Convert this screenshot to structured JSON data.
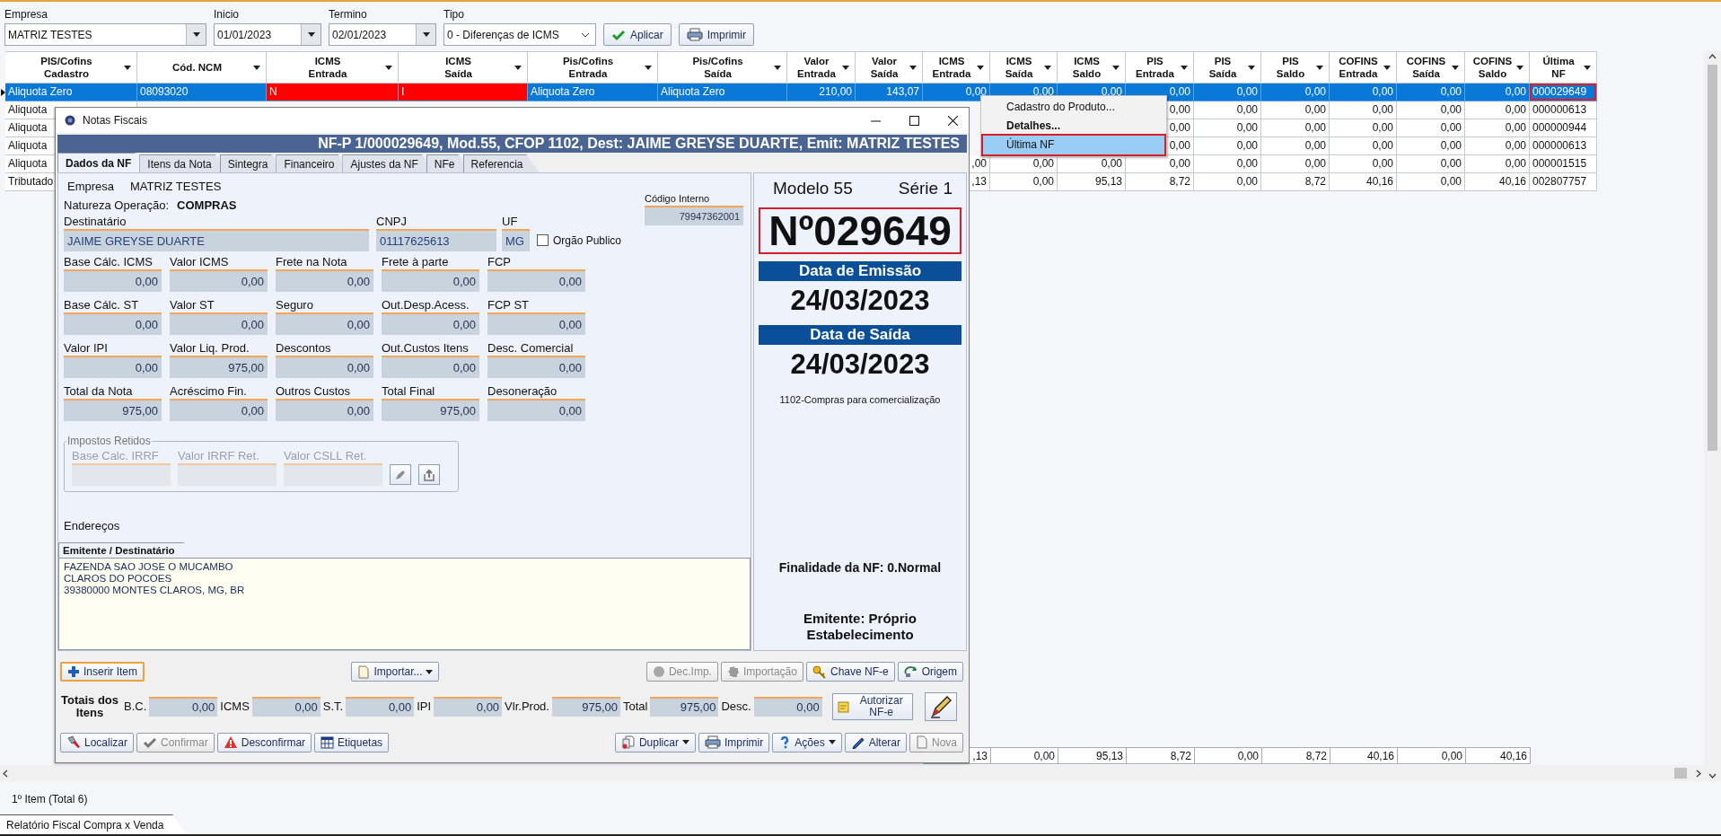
{
  "filters": {
    "fields": [
      {
        "label": "Empresa",
        "value": "MATRIZ TESTES",
        "kind": "combo"
      },
      {
        "label": "Inicio",
        "value": "01/01/2023",
        "kind": "combo"
      },
      {
        "label": "Termino",
        "value": "02/01/2023",
        "kind": "combo"
      },
      {
        "label": "Tipo",
        "value": "0 - Diferenças de ICMS",
        "kind": "select"
      }
    ],
    "buttons": [
      {
        "label": "Aplicar",
        "kind": "check"
      },
      {
        "label": "Imprimir",
        "kind": "printer"
      }
    ]
  },
  "grid": {
    "columns": [
      {
        "lines": [
          "PIS/Cofins",
          "Cadastro"
        ]
      },
      {
        "lines": [
          "Cód. NCM"
        ]
      },
      {
        "lines": [
          "ICMS",
          "Entrada"
        ]
      },
      {
        "lines": [
          "ICMS",
          "Saída"
        ]
      },
      {
        "lines": [
          "Pis/Cofins",
          "Entrada"
        ]
      },
      {
        "lines": [
          "Pis/Cofins",
          "Saída"
        ]
      },
      {
        "lines": [
          "Valor",
          "Entrada"
        ]
      },
      {
        "lines": [
          "Valor",
          "Saída"
        ]
      },
      {
        "lines": [
          "ICMS",
          "Entrada"
        ]
      },
      {
        "lines": [
          "ICMS",
          "Saída"
        ]
      },
      {
        "lines": [
          "ICMS",
          "Saldo"
        ]
      },
      {
        "lines": [
          "PIS",
          "Entrada"
        ]
      },
      {
        "lines": [
          "PIS",
          "Saída"
        ]
      },
      {
        "lines": [
          "PIS",
          "Saldo"
        ]
      },
      {
        "lines": [
          "COFINS",
          "Entrada"
        ]
      },
      {
        "lines": [
          "COFINS",
          "Saída"
        ]
      },
      {
        "lines": [
          "COFINS",
          "Saldo"
        ]
      },
      {
        "lines": [
          "Última",
          "NF"
        ]
      }
    ],
    "rows": [
      {
        "selected": true,
        "cells": [
          "Aliquota Zero",
          "08093020",
          {
            "text": "N",
            "alert": true
          },
          {
            "text": "I",
            "alert": true
          },
          "Aliquota Zero",
          "Aliquota Zero",
          "210,00",
          "143,07",
          "0,00",
          "0,00",
          "0,00",
          "0,00",
          "0,00",
          "0,00",
          "0,00",
          "0,00",
          "0,00",
          {
            "text": "000029649",
            "highlighted": true
          }
        ]
      },
      {
        "selected": false,
        "cells": [
          "Aliquota",
          null,
          null,
          null,
          null,
          null,
          null,
          null,
          null,
          null,
          null,
          "0,00",
          "0,00",
          "0,00",
          "0,00",
          "0,00",
          "0,00",
          "000000613"
        ]
      },
      {
        "selected": false,
        "cells": [
          "Aliquota",
          null,
          null,
          null,
          null,
          null,
          null,
          null,
          null,
          null,
          null,
          "0,00",
          "0,00",
          "0,00",
          "0,00",
          "0,00",
          "0,00",
          "000000944"
        ]
      },
      {
        "selected": false,
        "cells": [
          "Aliquota",
          null,
          null,
          null,
          null,
          null,
          null,
          null,
          null,
          null,
          null,
          "0,00",
          "0,00",
          "0,00",
          "0,00",
          "0,00",
          "0,00",
          "000000613"
        ]
      },
      {
        "selected": false,
        "cells": [
          "Aliquota",
          null,
          null,
          null,
          null,
          null,
          null,
          null,
          ",00",
          "0,00",
          "0,00",
          "0,00",
          "0,00",
          "0,00",
          "0,00",
          "0,00",
          "0,00",
          "000001515"
        ]
      },
      {
        "selected": false,
        "cells": [
          "Tributado",
          null,
          null,
          null,
          null,
          null,
          null,
          null,
          ",13",
          "0,00",
          "95,13",
          "8,72",
          "0,00",
          "8,72",
          "40,16",
          "0,00",
          "40,16",
          "002807757"
        ]
      }
    ],
    "footer": [
      ",13",
      "0,00",
      "95,13",
      "8,72",
      "0,00",
      "8,72",
      "40,16",
      "0,00",
      "40,16"
    ]
  },
  "context_menu": {
    "items": [
      {
        "label": "Cadastro do Produto...",
        "bold": false,
        "selected": false,
        "highlighted": false
      },
      {
        "label": "Detalhes...",
        "bold": true,
        "selected": false,
        "highlighted": false
      },
      {
        "label": "Última NF",
        "bold": false,
        "selected": true,
        "highlighted": true
      }
    ]
  },
  "dialog": {
    "title": "Notas Fiscais",
    "banner": "NF-P 1/000029649, Mod.55, CFOP 1102, Dest: JAIME GREYSE DUARTE, Emit: MATRIZ TESTES",
    "tabs": [
      {
        "label": "Dados da NF",
        "selected": true
      },
      {
        "label": "Itens da Nota",
        "selected": false
      },
      {
        "label": "Sintegra",
        "selected": false
      },
      {
        "label": "Financeiro",
        "selected": false
      },
      {
        "label": "Ajustes da NF",
        "selected": false
      },
      {
        "label": "NFe",
        "selected": false
      },
      {
        "label": "Referencia",
        "selected": false
      }
    ],
    "empresa": {
      "label": "Empresa",
      "value": "MATRIZ TESTES"
    },
    "natureza": {
      "label": "Natureza Operação:",
      "value": "COMPRAS"
    },
    "codigo_interno": {
      "label": "Código Interno",
      "value": "79947362001"
    },
    "destinatario": {
      "label": "Destinatário",
      "value": "JAIME GREYSE DUARTE"
    },
    "cnpj": {
      "label": "CNPJ",
      "value": "01117625613"
    },
    "uf": {
      "label": "UF",
      "value": "MG"
    },
    "orgao_publico": {
      "label": "Orgão Publico",
      "checked": false
    },
    "amounts": [
      {
        "caption": "Base Cálc. ICMS",
        "amount": "0,00"
      },
      {
        "caption": "Valor ICMS",
        "amount": "0,00"
      },
      {
        "caption": "Frete na Nota",
        "amount": "0,00"
      },
      {
        "caption": "Frete à parte",
        "amount": "0,00"
      },
      {
        "caption": "FCP",
        "amount": "0,00"
      },
      {
        "caption": "Base Cálc. ST",
        "amount": "0,00"
      },
      {
        "caption": "Valor ST",
        "amount": "0,00"
      },
      {
        "caption": "Seguro",
        "amount": "0,00"
      },
      {
        "caption": "Out.Desp.Acess.",
        "amount": "0,00"
      },
      {
        "caption": "FCP ST",
        "amount": "0,00"
      },
      {
        "caption": "Valor IPI",
        "amount": "0,00"
      },
      {
        "caption": "Valor Liq. Prod.",
        "amount": "975,00"
      },
      {
        "caption": "Descontos",
        "amount": "0,00"
      },
      {
        "caption": "Out.Custos Itens",
        "amount": "0,00"
      },
      {
        "caption": "Desc. Comercial",
        "amount": "0,00"
      },
      {
        "caption": "Total da Nota",
        "amount": "975,00"
      },
      {
        "caption": "Acréscimo Fin.",
        "amount": "0,00"
      },
      {
        "caption": "Outros Custos",
        "amount": "0,00"
      },
      {
        "caption": "Total Final",
        "amount": "975,00"
      },
      {
        "caption": "Desoneração",
        "amount": "0,00"
      }
    ],
    "impostos_retidos": {
      "title": "Impostos Retidos",
      "fields": [
        {
          "label": "Base Calc. IRRF"
        },
        {
          "label": "Valor IRRF Ret."
        },
        {
          "label": "Valor CSLL Ret."
        }
      ]
    },
    "enderecos": {
      "label": "Endereços",
      "tab": "Emitente / Destinatário",
      "lines": [
        "FAZENDA SAO JOSE O MUCAMBO",
        "CLAROS DO POCOES",
        "39380000 MONTES CLAROS, MG, BR"
      ]
    },
    "summary": {
      "modelo": "Modelo 55",
      "serie": "Série 1",
      "numero": "Nº029649",
      "highlighted": true,
      "emissao_label": "Data de Emissão",
      "emissao": "24/03/2023",
      "saida_label": "Data de Saída",
      "saida": "24/03/2023",
      "cfop": "1102-Compras para comercialização",
      "finalidade": "Finalidade da NF: 0.Normal",
      "emitente": "Emitente: Próprio Estabelecimento"
    },
    "item_buttons": [
      {
        "label": "Inserir Item",
        "kind": "plus",
        "focused": true,
        "disabled": false,
        "dropdown": false
      },
      {
        "label": "Importar...",
        "kind": "document",
        "focused": false,
        "disabled": false,
        "dropdown": true
      },
      {
        "label": "Dec.Imp.",
        "kind": "circle",
        "focused": false,
        "disabled": true,
        "dropdown": false
      },
      {
        "label": "Importação",
        "kind": "seal",
        "focused": false,
        "disabled": true,
        "dropdown": false
      },
      {
        "label": "Chave NF-e",
        "kind": "key",
        "focused": false,
        "disabled": false,
        "dropdown": false
      },
      {
        "label": "Origem",
        "kind": "arrows",
        "focused": false,
        "disabled": false,
        "dropdown": false
      }
    ],
    "totals": {
      "title": "Totais dos Itens",
      "fields": [
        {
          "label": "B.C.",
          "value": "0,00"
        },
        {
          "label": "ICMS",
          "value": "0,00"
        },
        {
          "label": "S.T.",
          "value": "0,00"
        },
        {
          "label": "IPI",
          "value": "0,00"
        },
        {
          "label": "Vlr.Prod.",
          "value": "975,00"
        },
        {
          "label": "Total",
          "value": "975,00"
        },
        {
          "label": "Desc.",
          "value": "0,00"
        }
      ],
      "authorize": "Autorizar NF-e"
    },
    "bottom_buttons": [
      {
        "label": "Localizar",
        "kind": "flashlight",
        "focused": false,
        "disabled": false,
        "dropdown": false
      },
      {
        "label": "Confirmar",
        "kind": "check",
        "focused": false,
        "disabled": true,
        "dropdown": false
      },
      {
        "label": "Desconfirmar",
        "kind": "warning",
        "focused": false,
        "disabled": false,
        "dropdown": false
      },
      {
        "label": "Etiquetas",
        "kind": "table",
        "focused": false,
        "disabled": false,
        "dropdown": false
      },
      {
        "label": "Duplicar",
        "kind": "documents",
        "focused": false,
        "disabled": false,
        "dropdown": true
      },
      {
        "label": "Imprimir",
        "kind": "printer",
        "focused": false,
        "disabled": false,
        "dropdown": false
      },
      {
        "label": "Ações",
        "kind": "help",
        "focused": false,
        "disabled": false,
        "dropdown": true
      },
      {
        "label": "Alterar",
        "kind": "pen",
        "focused": false,
        "disabled": false,
        "dropdown": false
      },
      {
        "label": "Nova",
        "kind": "document",
        "focused": false,
        "disabled": true,
        "dropdown": false
      }
    ]
  },
  "status": "1º Item (Total 6)",
  "bottom_tab": "Relatório Fiscal Compra x Venda"
}
